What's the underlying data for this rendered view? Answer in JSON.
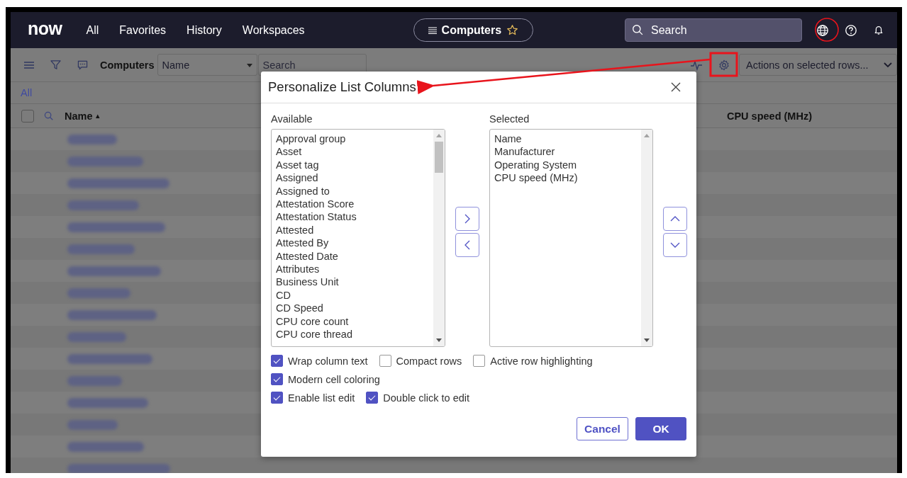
{
  "nav": {
    "logo": "now",
    "links": [
      "All",
      "Favorites",
      "History",
      "Workspaces"
    ],
    "context": {
      "label": "Computers"
    },
    "search": {
      "placeholder": "Search"
    }
  },
  "toolbar": {
    "title": "Computers",
    "field_select": {
      "value": "Name"
    },
    "search": {
      "placeholder": "Search"
    },
    "actions": {
      "value": "Actions on selected rows..."
    }
  },
  "breadcrumb": "All",
  "select_all": {
    "checked": false
  },
  "columns": [
    {
      "label": "Name",
      "sort": "▴"
    },
    {
      "label": "CPU speed (MHz)"
    }
  ],
  "dialog": {
    "title": "Personalize List Columns",
    "available": {
      "label": "Available",
      "items": [
        "Approval group",
        "Asset",
        "Asset tag",
        "Assigned",
        "Assigned to",
        "Attestation Score",
        "Attestation Status",
        "Attested",
        "Attested By",
        "Attested Date",
        "Attributes",
        "Business Unit",
        "CD",
        "CD Speed",
        "CPU core count",
        "CPU core thread"
      ]
    },
    "selected": {
      "label": "Selected",
      "items": [
        "Name",
        "Manufacturer",
        "Operating System",
        "CPU speed (MHz)"
      ]
    },
    "option_rows": [
      [
        {
          "label": "Wrap column text",
          "checked": true
        },
        {
          "label": "Compact rows",
          "checked": false
        },
        {
          "label": "Active row highlighting",
          "checked": false
        }
      ],
      [
        {
          "label": "Modern cell coloring",
          "checked": true
        }
      ],
      [
        {
          "label": "Enable list edit",
          "checked": true
        },
        {
          "label": "Double click to edit",
          "checked": true
        }
      ]
    ],
    "buttons": [
      {
        "label": "Cancel",
        "kind": "secondary"
      },
      {
        "label": "OK",
        "kind": "primary"
      }
    ]
  }
}
